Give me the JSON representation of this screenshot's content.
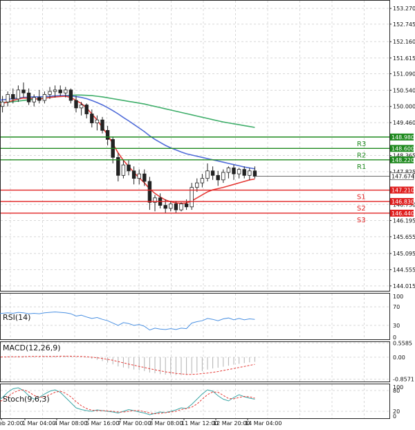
{
  "colors": {
    "bull": "#2e8b2e",
    "bear": "#c62828",
    "ema_red": "#e53935",
    "ema_blue": "#4f6bd8",
    "ema_green": "#3fae6a",
    "resistance": "#1f8a1f",
    "support": "#e02020",
    "grid": "#d8d8d8",
    "rsi": "#4a90e2",
    "macd_hist": "#b0b0b0",
    "macd_signal": "#e53935",
    "stoch_main": "#3aa6a6",
    "stoch_signal": "#e53935"
  },
  "chart_data": [
    {
      "type": "candlestick",
      "name": "price",
      "y_ticks": [
        "153.270",
        "152.475",
        "151.615",
        "150.800",
        "150.540",
        "149.460",
        "148.365",
        "147.825",
        "146.730",
        "146.195",
        "145.655",
        "145.095",
        "144.555",
        "144.015"
      ],
      "y_tick_values": [
        153.27,
        152.745,
        152.16,
        151.615,
        151.09,
        150.54,
        150.0,
        149.46,
        148.365,
        147.825,
        146.73,
        146.195,
        145.655,
        145.095,
        144.555,
        144.015
      ],
      "y_tick_labels": [
        "153.270",
        "152.745",
        "152.160",
        "151.615",
        "151.090",
        "150.540",
        "150.000",
        "149.460",
        "148.365",
        "147.825",
        "146.730",
        "146.195",
        "145.655",
        "145.095",
        "144.555",
        "144.015"
      ],
      "ylim": [
        143.85,
        153.55
      ],
      "x_labels": [
        "eb 20:00",
        "1 Mar 04:00",
        "4 Mar 08:00",
        "5 Mar 16:00",
        "7 Mar 00:00",
        "8 Mar 08:00",
        "11 Mar 12:00",
        "12 Mar 20:00",
        "14 Mar 04:00"
      ],
      "candles": [
        [
          149.7,
          150.2,
          149.3,
          150.0
        ],
        [
          150.0,
          150.35,
          149.8,
          150.15
        ],
        [
          150.15,
          150.5,
          150.0,
          150.4
        ],
        [
          150.4,
          150.6,
          150.1,
          150.25
        ],
        [
          150.25,
          150.7,
          150.15,
          150.55
        ],
        [
          150.55,
          150.8,
          150.3,
          150.45
        ],
        [
          150.45,
          150.6,
          150.05,
          150.15
        ],
        [
          150.15,
          150.4,
          150.0,
          150.3
        ],
        [
          150.3,
          150.55,
          150.1,
          150.2
        ],
        [
          150.2,
          150.5,
          150.1,
          150.4
        ],
        [
          150.4,
          150.65,
          150.25,
          150.5
        ],
        [
          150.5,
          150.7,
          150.3,
          150.55
        ],
        [
          150.55,
          150.7,
          150.35,
          150.45
        ],
        [
          150.45,
          150.65,
          150.3,
          150.55
        ],
        [
          150.55,
          150.6,
          150.1,
          150.2
        ],
        [
          150.2,
          150.35,
          149.8,
          149.95
        ],
        [
          149.95,
          150.15,
          149.7,
          150.05
        ],
        [
          150.05,
          150.1,
          149.6,
          149.75
        ],
        [
          149.75,
          149.9,
          149.3,
          149.45
        ],
        [
          149.45,
          149.7,
          149.2,
          149.55
        ],
        [
          149.55,
          149.65,
          149.1,
          149.2
        ],
        [
          149.2,
          149.35,
          148.7,
          148.9
        ],
        [
          148.9,
          149.0,
          148.1,
          148.3
        ],
        [
          148.3,
          148.45,
          147.5,
          147.7
        ],
        [
          147.7,
          148.2,
          147.6,
          148.05
        ],
        [
          148.05,
          148.2,
          147.7,
          147.85
        ],
        [
          147.85,
          148.0,
          147.4,
          147.6
        ],
        [
          147.6,
          147.9,
          147.4,
          147.75
        ],
        [
          147.75,
          147.9,
          147.35,
          147.5
        ],
        [
          147.5,
          147.65,
          146.55,
          146.8
        ],
        [
          146.8,
          147.05,
          146.5,
          146.95
        ],
        [
          146.95,
          147.1,
          146.6,
          146.7
        ],
        [
          146.7,
          146.9,
          146.45,
          146.6
        ],
        [
          146.6,
          146.85,
          146.5,
          146.75
        ],
        [
          146.75,
          146.85,
          146.45,
          146.55
        ],
        [
          146.55,
          146.8,
          146.5,
          146.75
        ],
        [
          146.75,
          146.9,
          146.55,
          146.65
        ],
        [
          146.65,
          147.45,
          146.55,
          147.3
        ],
        [
          147.3,
          147.6,
          147.15,
          147.45
        ],
        [
          147.45,
          147.75,
          147.3,
          147.6
        ],
        [
          147.6,
          148.1,
          147.5,
          147.85
        ],
        [
          147.85,
          148.0,
          147.55,
          147.7
        ],
        [
          147.7,
          147.85,
          147.35,
          147.55
        ],
        [
          147.55,
          147.9,
          147.45,
          147.8
        ],
        [
          147.8,
          148.0,
          147.6,
          147.95
        ],
        [
          147.95,
          148.05,
          147.55,
          147.75
        ],
        [
          147.75,
          147.95,
          147.6,
          147.9
        ],
        [
          147.9,
          148.0,
          147.6,
          147.7
        ],
        [
          147.7,
          147.95,
          147.55,
          147.85
        ],
        [
          147.85,
          148.0,
          147.6,
          147.67
        ]
      ],
      "ema_red": [
        150.05,
        150.1,
        150.15,
        150.2,
        150.25,
        150.28,
        150.27,
        150.26,
        150.25,
        150.27,
        150.3,
        150.32,
        150.33,
        150.34,
        150.3,
        150.2,
        150.1,
        149.95,
        149.75,
        149.55,
        149.3,
        149.05,
        148.75,
        148.45,
        148.2,
        148.0,
        147.8,
        147.62,
        147.45,
        147.25,
        147.1,
        146.98,
        146.88,
        146.82,
        146.78,
        146.77,
        146.78,
        146.85,
        146.95,
        147.05,
        147.15,
        147.22,
        147.26,
        147.3,
        147.35,
        147.4,
        147.45,
        147.5,
        147.55,
        147.58
      ],
      "ema_blue": [
        150.2,
        150.22,
        150.24,
        150.26,
        150.28,
        150.3,
        150.31,
        150.32,
        150.32,
        150.33,
        150.34,
        150.35,
        150.36,
        150.36,
        150.35,
        150.33,
        150.3,
        150.26,
        150.2,
        150.13,
        150.05,
        149.96,
        149.86,
        149.75,
        149.63,
        149.52,
        149.4,
        149.28,
        149.16,
        149.02,
        148.9,
        148.8,
        148.7,
        148.62,
        148.55,
        148.48,
        148.42,
        148.38,
        148.34,
        148.3,
        148.26,
        148.22,
        148.18,
        148.14,
        148.1,
        148.06,
        148.02,
        147.98,
        147.95,
        147.92
      ],
      "ema_green": [
        150.1,
        150.12,
        150.14,
        150.16,
        150.18,
        150.2,
        150.22,
        150.24,
        150.26,
        150.28,
        150.3,
        150.32,
        150.34,
        150.36,
        150.37,
        150.38,
        150.38,
        150.37,
        150.36,
        150.34,
        150.32,
        150.29,
        150.26,
        150.23,
        150.2,
        150.17,
        150.14,
        150.11,
        150.08,
        150.04,
        150.0,
        149.96,
        149.92,
        149.88,
        149.84,
        149.8,
        149.76,
        149.72,
        149.68,
        149.64,
        149.6,
        149.56,
        149.52,
        149.48,
        149.45,
        149.42,
        149.39,
        149.36,
        149.33,
        149.3
      ],
      "levels": [
        {
          "name": "R3",
          "value": 148.98,
          "kind": "resistance"
        },
        {
          "name": "R2",
          "value": 148.6,
          "kind": "resistance"
        },
        {
          "name": "R1",
          "value": 148.22,
          "kind": "resistance"
        },
        {
          "name": "S1",
          "value": 147.21,
          "kind": "support"
        },
        {
          "name": "S2",
          "value": 146.83,
          "kind": "support"
        },
        {
          "name": "S3",
          "value": 146.44,
          "kind": "support"
        }
      ],
      "level_labels": [
        "148.980",
        "148.600",
        "148.220",
        "147.210",
        "146.830",
        "146.440"
      ],
      "current_price": 147.674,
      "current_label": "147.674"
    },
    {
      "type": "line",
      "name": "rsi",
      "title": "RSI(14)",
      "ylim": [
        0,
        100
      ],
      "y_ticks": [
        100,
        70,
        30,
        0
      ],
      "y_tick_labels": [
        "100",
        "70",
        "30",
        "0"
      ],
      "values": [
        55,
        56,
        57,
        56,
        58,
        57,
        55,
        56,
        55,
        57,
        58,
        59,
        58,
        57,
        55,
        50,
        52,
        48,
        45,
        47,
        43,
        40,
        35,
        30,
        36,
        34,
        30,
        32,
        28,
        20,
        24,
        22,
        21,
        23,
        21,
        24,
        23,
        35,
        38,
        40,
        45,
        43,
        40,
        44,
        46,
        42,
        45,
        42,
        44,
        43
      ]
    },
    {
      "type": "bar_line",
      "name": "macd",
      "title": "MACD(12,26,9)",
      "ylim": [
        -0.95,
        0.62
      ],
      "y_ticks": [
        0.5585,
        0.0,
        -0.8571
      ],
      "y_tick_labels": [
        "0.5585",
        "0.00",
        "-0.8571"
      ],
      "hist": [
        0.02,
        0.03,
        0.04,
        0.04,
        0.05,
        0.05,
        0.04,
        0.04,
        0.03,
        0.04,
        0.05,
        0.05,
        0.05,
        0.05,
        0.04,
        0.02,
        0.01,
        -0.02,
        -0.06,
        -0.1,
        -0.15,
        -0.21,
        -0.28,
        -0.36,
        -0.4,
        -0.44,
        -0.48,
        -0.51,
        -0.54,
        -0.6,
        -0.63,
        -0.66,
        -0.68,
        -0.69,
        -0.7,
        -0.7,
        -0.69,
        -0.64,
        -0.59,
        -0.54,
        -0.48,
        -0.44,
        -0.41,
        -0.37,
        -0.33,
        -0.29,
        -0.26,
        -0.23,
        -0.2,
        -0.18
      ],
      "signal": [
        0.0,
        0.01,
        0.01,
        0.02,
        0.02,
        0.02,
        0.03,
        0.03,
        0.03,
        0.03,
        0.03,
        0.03,
        0.04,
        0.04,
        0.04,
        0.03,
        0.03,
        0.02,
        0.0,
        -0.02,
        -0.05,
        -0.08,
        -0.12,
        -0.17,
        -0.22,
        -0.27,
        -0.31,
        -0.36,
        -0.4,
        -0.45,
        -0.49,
        -0.53,
        -0.57,
        -0.6,
        -0.63,
        -0.65,
        -0.67,
        -0.67,
        -0.66,
        -0.64,
        -0.62,
        -0.59,
        -0.56,
        -0.52,
        -0.48,
        -0.44,
        -0.4,
        -0.36,
        -0.32,
        -0.28
      ]
    },
    {
      "type": "line",
      "name": "stochastic",
      "title": "Stoch(9,6,3)",
      "ylim": [
        0,
        100
      ],
      "y_ticks": [
        100,
        80,
        20,
        0
      ],
      "y_tick_labels": [
        "100",
        "80",
        "20",
        "0"
      ],
      "main": [
        50,
        60,
        75,
        85,
        88,
        80,
        65,
        55,
        60,
        70,
        78,
        82,
        75,
        60,
        45,
        30,
        25,
        22,
        20,
        24,
        22,
        20,
        18,
        15,
        20,
        25,
        22,
        18,
        15,
        10,
        14,
        18,
        16,
        20,
        24,
        30,
        28,
        40,
        55,
        70,
        82,
        78,
        65,
        55,
        50,
        60,
        68,
        62,
        58,
        55
      ],
      "signal": [
        45,
        52,
        62,
        73,
        80,
        82,
        76,
        66,
        60,
        62,
        68,
        75,
        78,
        72,
        62,
        48,
        36,
        28,
        23,
        22,
        22,
        21,
        20,
        18,
        18,
        20,
        22,
        22,
        19,
        15,
        13,
        14,
        16,
        18,
        20,
        25,
        28,
        32,
        41,
        55,
        68,
        76,
        75,
        66,
        57,
        56,
        60,
        63,
        62,
        58
      ]
    }
  ]
}
